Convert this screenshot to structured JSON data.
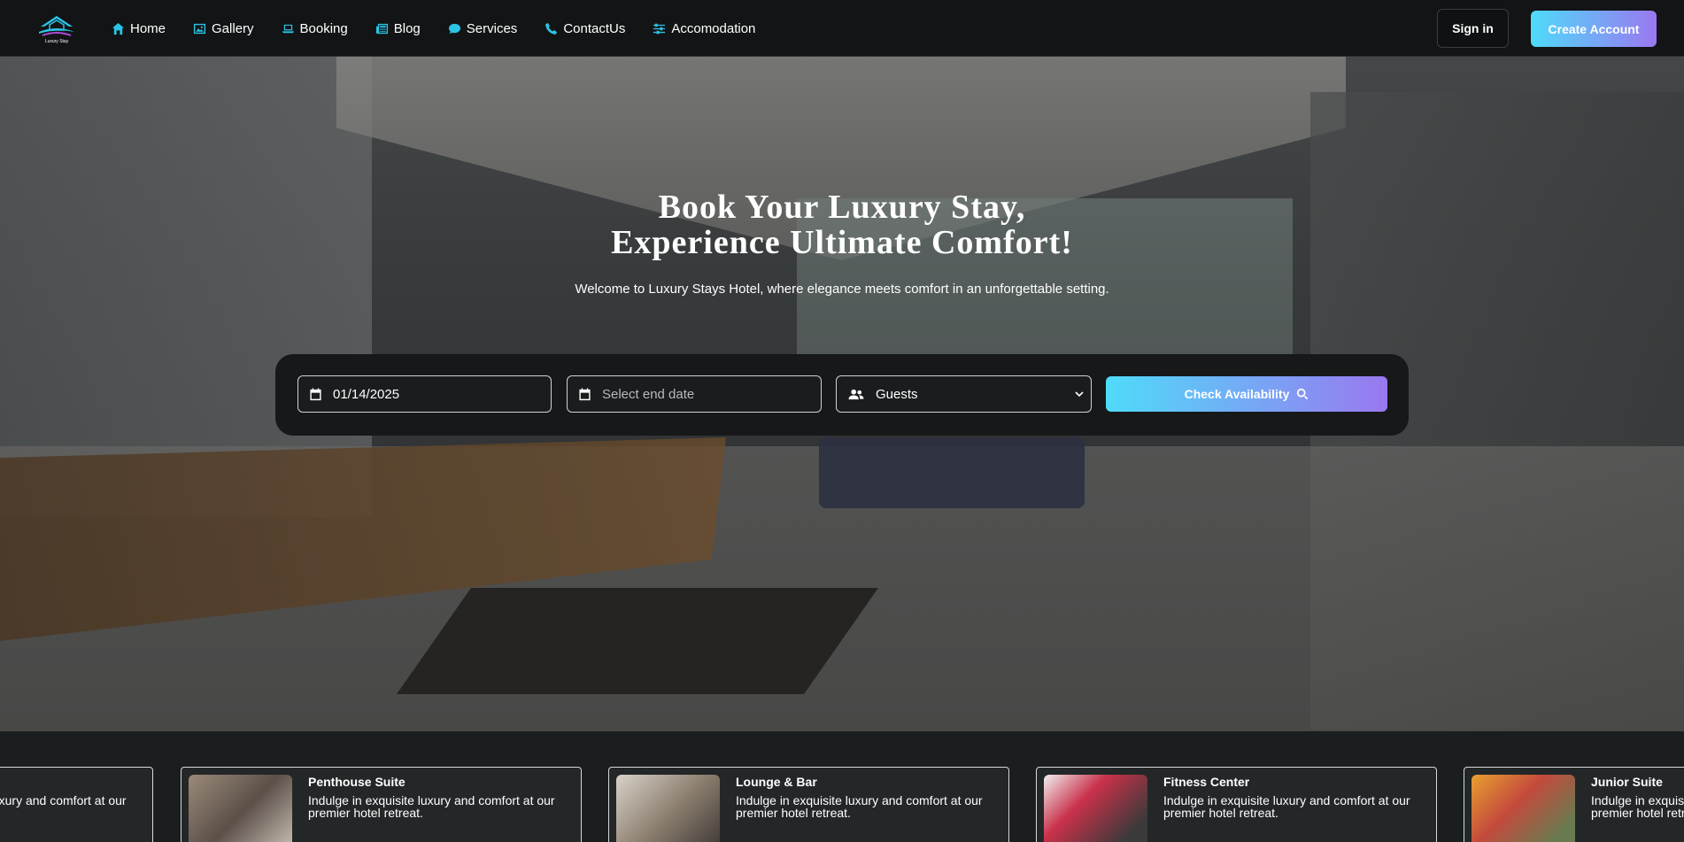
{
  "nav": {
    "logo_text": "Luxury Stay",
    "items": [
      {
        "label": "Home",
        "icon": "home-icon"
      },
      {
        "label": "Gallery",
        "icon": "image-icon"
      },
      {
        "label": "Booking",
        "icon": "laptop-icon"
      },
      {
        "label": "Blog",
        "icon": "newspaper-icon"
      },
      {
        "label": "Services",
        "icon": "chat-icon"
      },
      {
        "label": "ContactUs",
        "icon": "phone-icon"
      },
      {
        "label": "Accomodation",
        "icon": "sliders-icon"
      }
    ],
    "signin_label": "Sign in",
    "create_label": "Create Account"
  },
  "hero": {
    "title_line1": "Book Your Luxury Stay,",
    "title_line2": "Experience Ultimate Comfort!",
    "subtitle": "Welcome to Luxury Stays Hotel, where elegance meets comfort in an unforgettable setting."
  },
  "booking": {
    "start_date": "01/14/2025",
    "end_placeholder": "Select end date",
    "guests_selected": "Guests",
    "check_label": "Check Availability"
  },
  "cards": [
    {
      "title": "",
      "desc": "Indulge in exquisite luxury and comfort at our premier hotel retreat."
    },
    {
      "title": "Penthouse Suite",
      "desc": "Indulge in exquisite luxury and comfort at our premier hotel retreat."
    },
    {
      "title": "Lounge & Bar",
      "desc": "Indulge in exquisite luxury and comfort at our premier hotel retreat."
    },
    {
      "title": "Fitness Center",
      "desc": "Indulge in exquisite luxury and comfort at our premier hotel retreat."
    },
    {
      "title": "Junior Suite",
      "desc": "Indulge in exquisite luxury and comfort at our premier hotel retreat."
    }
  ],
  "colors": {
    "accent_start": "#4fdbfa",
    "accent_end": "#9a78f0",
    "nav_icon": "#2bc4e6",
    "navbar_bg": "#121415"
  }
}
